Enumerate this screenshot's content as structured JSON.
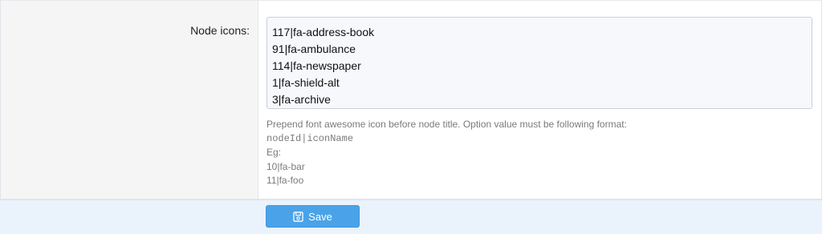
{
  "form": {
    "label": "Node icons:",
    "textarea_value": "117|fa-address-book\n91|fa-ambulance\n114|fa-newspaper\n1|fa-shield-alt\n3|fa-archive",
    "help": {
      "line1": "Prepend font awesome icon before node title. Option value must be following format:",
      "format": "nodeId|iconName",
      "eg_label": "Eg:",
      "example1": "10|fa-bar",
      "example2": "11|fa-foo"
    }
  },
  "footer": {
    "save_label": "Save",
    "save_icon": "save-icon"
  }
}
